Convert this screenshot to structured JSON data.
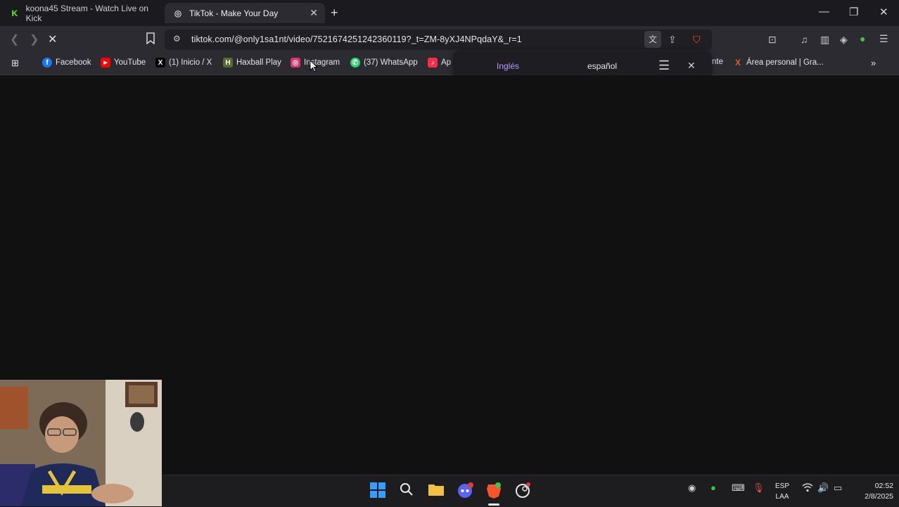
{
  "tabs": [
    {
      "title": "koona45 Stream - Watch Live on Kick",
      "favicon": "K"
    },
    {
      "title": "TikTok - Make Your Day",
      "favicon": "◎"
    }
  ],
  "toolbar": {
    "url": "tiktok.com/@only1sa1nt/video/7521674251242360119?_t=ZM-8yXJ4NPqdaY&_r=1"
  },
  "bookmarks": [
    {
      "label": "Facebook",
      "icon": "facebook-icon",
      "color": "#1877f2",
      "glyph": "f"
    },
    {
      "label": "YouTube",
      "icon": "youtube-icon",
      "color": "#ff0000",
      "glyph": "▶"
    },
    {
      "label": "(1) Inicio / X",
      "icon": "x-icon",
      "color": "#000000",
      "glyph": "X"
    },
    {
      "label": "Haxball Play",
      "icon": "haxball-icon",
      "color": "#556b2f",
      "glyph": "H"
    },
    {
      "label": "Instagram",
      "icon": "instagram-icon",
      "color": "#e1306c",
      "glyph": "◎"
    },
    {
      "label": "(37) WhatsApp",
      "icon": "whatsapp-icon",
      "color": "#25d366",
      "glyph": "✆"
    },
    {
      "label": "Ap",
      "icon": "apple-music-icon",
      "color": "#fa2d48",
      "glyph": "♪"
    },
    {
      "label": "nte",
      "icon": "",
      "color": "",
      "glyph": ""
    },
    {
      "label": "Área personal | Gra...",
      "icon": "area-personal-icon",
      "color": "#e05a2b",
      "glyph": "X"
    }
  ],
  "translate_popup": {
    "source_lang": "Inglés",
    "target_lang": "español",
    "accent": "#a68af0"
  },
  "taskbar": {
    "lang_top": "ESP",
    "lang_bottom": "LAA",
    "time": "02:52",
    "date": "2/8/2025"
  }
}
